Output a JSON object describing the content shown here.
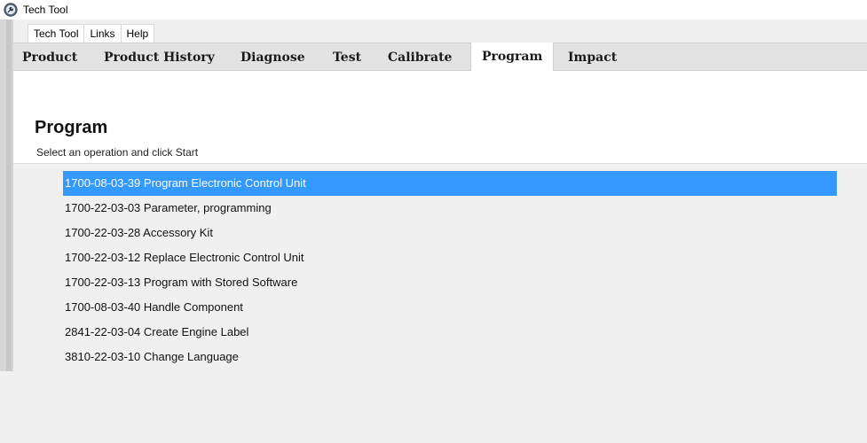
{
  "window": {
    "title": "Tech Tool",
    "icon": "tech-tool-app-icon"
  },
  "menu": {
    "items": [
      "Tech Tool",
      "Links",
      "Help"
    ]
  },
  "tabs": {
    "items": [
      "Product",
      "Product History",
      "Diagnose",
      "Test",
      "Calibrate",
      "Program",
      "Impact"
    ],
    "active": "Program"
  },
  "page": {
    "title": "Program",
    "subtitle": "Select an operation and click Start"
  },
  "operations": {
    "selected_index": 0,
    "selection_color": "#3399ff",
    "items": [
      "1700-08-03-39 Program Electronic Control Unit",
      "1700-22-03-03 Parameter, programming",
      "1700-22-03-28 Accessory Kit",
      "1700-22-03-12 Replace Electronic Control Unit",
      "1700-22-03-13 Program with Stored Software",
      "1700-08-03-40 Handle Component",
      "2841-22-03-04 Create Engine Label",
      "3810-22-03-10 Change Language"
    ]
  }
}
